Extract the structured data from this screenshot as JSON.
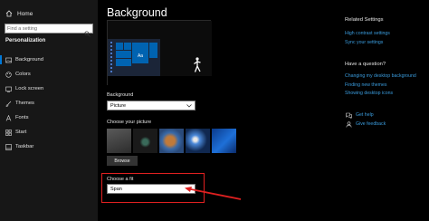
{
  "sidebar": {
    "home_label": "Home",
    "search_placeholder": "Find a setting",
    "section_title": "Personalization",
    "items": [
      {
        "label": "Background",
        "icon": "picture-icon",
        "active": true
      },
      {
        "label": "Colors",
        "icon": "palette-icon",
        "active": false
      },
      {
        "label": "Lock screen",
        "icon": "lock-screen-icon",
        "active": false
      },
      {
        "label": "Themes",
        "icon": "brush-icon",
        "active": false
      },
      {
        "label": "Fonts",
        "icon": "font-icon",
        "active": false
      },
      {
        "label": "Start",
        "icon": "start-icon",
        "active": false
      },
      {
        "label": "Taskbar",
        "icon": "taskbar-icon",
        "active": false
      }
    ]
  },
  "main": {
    "title": "Background",
    "preview_tile_label": "Aa",
    "background_label": "Background",
    "background_value": "Picture",
    "choose_picture_label": "Choose your picture",
    "browse_label": "Browse",
    "fit_label": "Choose a fit",
    "fit_value": "Span"
  },
  "right": {
    "related_title": "Related Settings",
    "related_links": [
      "High contrast settings",
      "Sync your settings"
    ],
    "question_title": "Have a question?",
    "question_links": [
      "Changing my desktop background",
      "Finding new themes",
      "Showing desktop icons"
    ],
    "get_help": "Get help",
    "give_feedback": "Give feedback"
  },
  "colors": {
    "accent": "#0078d7",
    "link": "#3a9bdc",
    "annotation": "#e02020"
  }
}
